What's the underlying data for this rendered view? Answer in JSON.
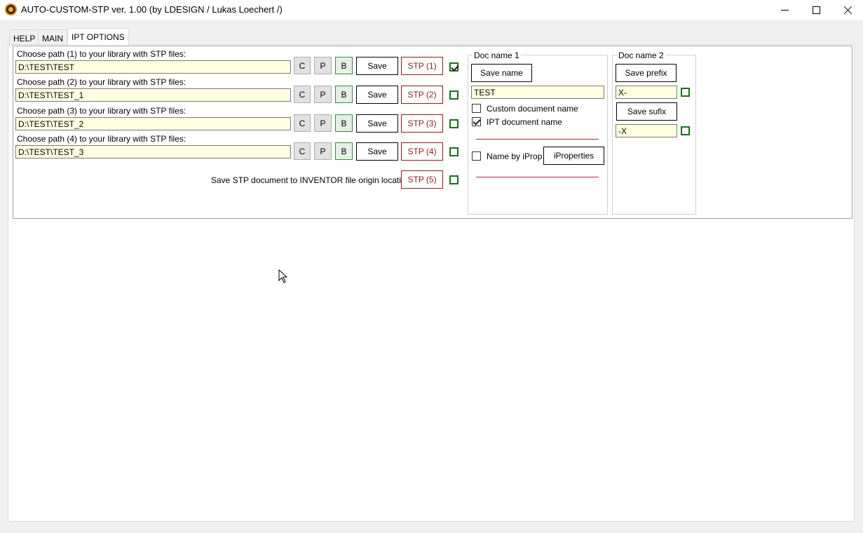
{
  "window": {
    "title": "AUTO-CUSTOM-STP ver. 1.00 (by LDESIGN / Lukas Loechert /)",
    "icon": "app-logo-icon",
    "controls": {
      "minimize": "minimize-icon",
      "maximize": "maximize-icon",
      "close": "close-icon"
    }
  },
  "tabs": [
    {
      "label": "HELP",
      "active": false
    },
    {
      "label": "MAIN",
      "active": false
    },
    {
      "label": "IPT OPTIONS",
      "active": true
    }
  ],
  "paths": [
    {
      "label": "Choose path (1) to your library with STP files:",
      "value": "D:\\TEST\\TEST",
      "stp_label": "STP (1)",
      "checked": true
    },
    {
      "label": "Choose path (2) to your library with STP files:",
      "value": "D:\\TEST\\TEST_1",
      "stp_label": "STP (2)",
      "checked": false
    },
    {
      "label": "Choose path (3) to your library with STP files:",
      "value": "D:\\TEST\\TEST_2",
      "stp_label": "STP (3)",
      "checked": false
    },
    {
      "label": "Choose path (4) to your library with STP files:",
      "value": "D:\\TEST\\TEST_3",
      "stp_label": "STP (4)",
      "checked": false
    }
  ],
  "path_buttons": {
    "c": "C",
    "p": "P",
    "b": "B",
    "save": "Save"
  },
  "origin": {
    "label": "Save STP document to INVENTOR file origin location:",
    "stp_label": "STP (5)",
    "checked": false
  },
  "doc_name_1": {
    "title": "Doc name 1",
    "save_name": "Save name",
    "value": "TEST",
    "custom_label": "Custom document name",
    "custom_checked": false,
    "ipt_label": "IPT document name",
    "ipt_checked": true,
    "iprop_label": "Name by iProp",
    "iprop_checked": false,
    "iproperties_button": "iProperties"
  },
  "doc_name_2": {
    "title": "Doc name 2",
    "save_prefix": "Save prefix",
    "prefix_value": "X-",
    "prefix_checked": false,
    "save_sufix": "Save sufix",
    "sufix_value": "-X",
    "sufix_checked": false
  },
  "colors": {
    "accent_green": "#1e6b1e",
    "stp_red": "#8b1a1a",
    "input_bg": "#ffffe1"
  }
}
